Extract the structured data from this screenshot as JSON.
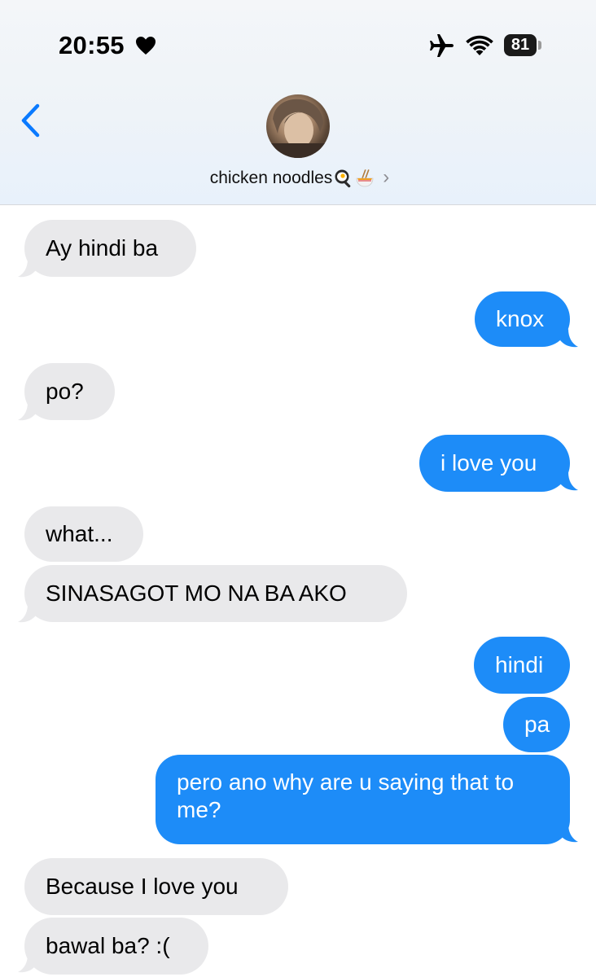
{
  "status_bar": {
    "time": "20:55",
    "heart": "heart-icon",
    "airplane": "airplane-icon",
    "wifi": "wifi-icon",
    "battery": "81"
  },
  "header": {
    "contact_name": "chicken noodles",
    "contact_emojis": [
      "egg-frying-icon",
      "noodle-bowl-icon"
    ],
    "chevron": "›"
  },
  "colors": {
    "sent_bubble": "#1d8cf8",
    "received_bubble": "#e9e9eb",
    "accent": "#0a7aff"
  },
  "messages": [
    {
      "direction": "received",
      "text": "Ay hindi ba"
    },
    {
      "direction": "sent",
      "text": "knox"
    },
    {
      "direction": "received",
      "text": "po?"
    },
    {
      "direction": "sent",
      "text": "i love you"
    },
    {
      "direction": "received",
      "text": "what..."
    },
    {
      "direction": "received",
      "text": "SINASAGOT MO NA BA AKO"
    },
    {
      "direction": "sent",
      "text": "hindi"
    },
    {
      "direction": "sent",
      "text": "pa"
    },
    {
      "direction": "sent",
      "text": "pero ano why are u saying that to me?"
    },
    {
      "direction": "received",
      "text": "Because I love you"
    },
    {
      "direction": "received",
      "text": "bawal ba? :("
    }
  ]
}
